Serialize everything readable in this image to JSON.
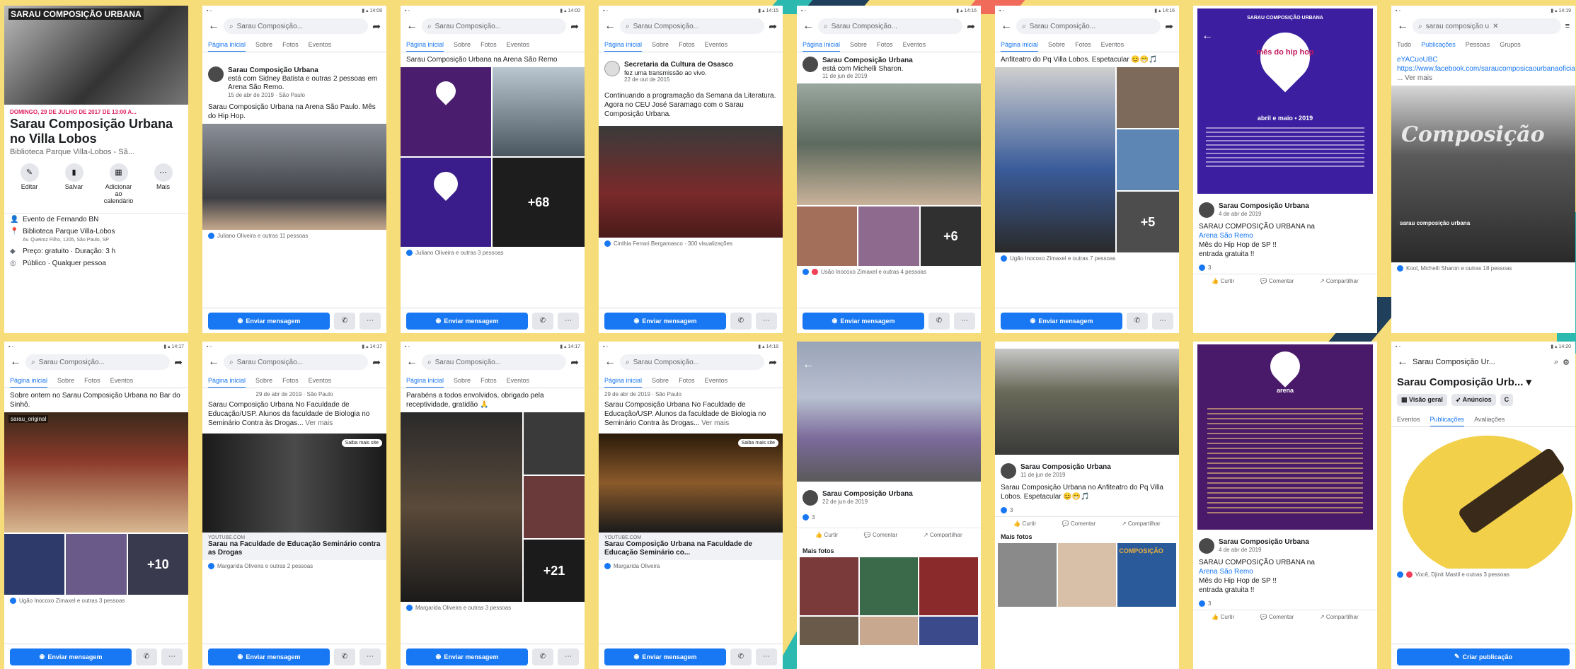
{
  "colors": {
    "background": "#f7dc7a",
    "fb_blue": "#1877f2",
    "stripe_teal": "#2bb9b0",
    "stripe_navy": "#1f3f5a",
    "stripe_coral": "#f06b5a"
  },
  "common": {
    "search_placeholder": "Sarau Composição...",
    "tabs": [
      "Página inicial",
      "Sobre",
      "Fotos",
      "Eventos"
    ],
    "send_message": "Enviar mensagem",
    "like": "Curtir",
    "comment": "Comentar",
    "share": "Compartilhar",
    "more_photos": "Mais fotos"
  },
  "s1": {
    "banner_text": "SARAU COMPOSIÇÃO URBANA",
    "date_line": "DOMINGO, 29 DE JULHO DE 2017 DE 13:00 A...",
    "title": "Sarau Composição Urbana no Villa Lobos",
    "location": "Biblioteca Parque Villa-Lobos - Sã...",
    "actions": [
      "Editar",
      "Salvar",
      "Adicionar ao calendário",
      "Mais"
    ],
    "host": "Evento de Fernando BN",
    "place": "Biblioteca Parque Villa-Lobos",
    "address": "Av. Queiroz Filho, 1205, São Paulo, SP",
    "price": "Preço: gratuito · Duração: 3 h",
    "audience": "Público · Qualquer pessoa"
  },
  "s2": {
    "author": "Sarau Composição Urbana",
    "with": "está com Sidney Batista e outras 2 pessoas em Arena São Remo.",
    "date": "15 de abr de 2019 · São Paulo",
    "text": "Sarau Composição Urbana na Arena São Paulo. Mês do Hip Hop.",
    "reactions": "Juliano Oliveira e outras 11 pessoas"
  },
  "s3": {
    "text": "Sarau Composição Urbana na Arena São Remo",
    "more": "+68",
    "reactions": "Juliano Oliveira e outras 3 pessoas"
  },
  "s4": {
    "author": "Secretaria da Cultura de Osasco",
    "sub": "fez uma transmissão ao vivo.",
    "date": "22 de out de 2015",
    "text": "Continuando a programação da Semana da Literatura. Agora no CEU José Saramago com o Sarau Composição Urbana.",
    "reactions": "Cinthia Ferrari Bergamasco · 300 visualizações"
  },
  "s5": {
    "author": "Sarau Composição Urbana",
    "with": "está com Michelli Sharon.",
    "date": "11 de jun de 2019",
    "more": "+6",
    "reactions": "Usão Inocoxo Zimaxel e outras 4 pessoas"
  },
  "s6": {
    "text": "Anfiteatro do Pq Villa Lobos. Espetacular 😊😁🎵",
    "more": "+5",
    "reactions": "Ugão Inocoxo Zimaxel e outras 7 pessoas"
  },
  "s7": {
    "poster_top": "SARAU COMPOSIÇÃO URBANA",
    "poster_pin": "mês do hip hop",
    "poster_date": "abril e maio • 2019",
    "author": "Sarau Composição Urbana",
    "date": "4 de abr de 2019",
    "text1": "SARAU COMPOSIÇÃO URBANA na",
    "link": "Arena São Remo",
    "text2": "Mês do Hip Hop de SP !!",
    "text3": "entrada gratuita !!",
    "count": "3"
  },
  "s8": {
    "search": "sarau composição u",
    "tabs": [
      "Tudo",
      "Publicações",
      "Pessoas",
      "Grupos"
    ],
    "text1": "eYACuoUBC",
    "link": "https://www.facebook.com/saraucomposicaourbanaoficial",
    "more": "... Ver mais",
    "poster_title": "Composição",
    "poster_sub": "sarau composição urbana",
    "reactions": "Kool, Michelli Sharon e outras 18 pessoas"
  },
  "s9": {
    "text": "Sobre ontem no Sarau Composição Urbana no Bar do Sinhô.",
    "tag": "sarau_original",
    "more": "+10",
    "reactions": "Ugão Inocoxo Zimaxel e outras 3 pessoas"
  },
  "s10": {
    "date": "29 de abr de 2019 · São Paulo",
    "text": "Sarau Composição Urbana No Faculdade de Educação/USP. Alunos da faculdade de Biologia no Seminário Contra às Drogas...",
    "more": "Ver mais",
    "chip": "Saiba mais site",
    "domain": "YOUTUBE.COM",
    "link_title": "Sarau na Faculdade de Educação Seminário contra as Drogas",
    "reactions": "Margarida Oliveira e outras 2 pessoas"
  },
  "s11": {
    "text": "Parabéns a todos envolvidos, obrigado pela receptividade, gratidão 🙏",
    "more": "+21",
    "reactions": "Margarida Oliveira e outras 3 pessoas"
  },
  "s12": {
    "date": "29 de abr de 2019 · São Paulo",
    "text": "Sarau Composição Urbana No Faculdade de Educação/USP. Alunos da faculdade de Biologia no Seminário Contra às Drogas...",
    "more": "Ver mais",
    "chip": "Saiba mais site",
    "domain": "YOUTUBE.COM",
    "link_title": "Sarau Composição Urbana na Faculdade de Educação Seminário co...",
    "reactions": "Margarida Oliveira"
  },
  "s13": {
    "author": "Sarau Composição Urbana",
    "date": "22 de jun de 2019",
    "count": "3"
  },
  "s14": {
    "author": "Sarau Composição Urbana",
    "date": "11 de jun de 2019",
    "text": "Sarau Composição Urbana no Anfiteatro do Pq Villa Lobos. Espetacular 😊😁🎵",
    "count": "3",
    "photo_text": "COMPOSIÇÃO"
  },
  "s15": {
    "poster_pin": "arena",
    "author": "Sarau Composição Urbana",
    "date": "4 de abr de 2019",
    "text1": "SARAU COMPOSIÇÃO URBANA na",
    "link": "Arena São Remo",
    "text2": "Mês do Hip Hop de SP !!",
    "text3": "entrada gratuita !!",
    "count": "3"
  },
  "s16": {
    "title_bar": "Sarau Composição Ur...",
    "page_name": "Sarau Composição Urb...",
    "chips": [
      "Visão geral",
      "Anúncios",
      "C"
    ],
    "tabs": [
      "Eventos",
      "Publicações",
      "Avaliações"
    ],
    "reactions": "Você, Djinit Mastil e outras 3 pessoas",
    "create": "Criar publicação"
  }
}
